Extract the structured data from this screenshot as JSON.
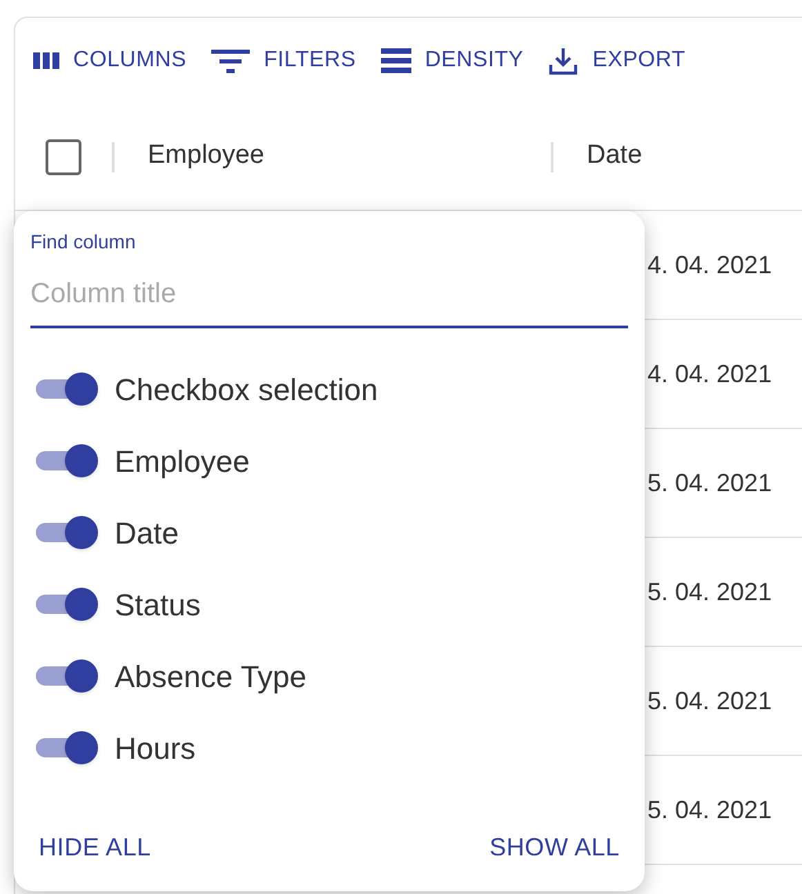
{
  "toolbar": [
    {
      "kind": "columns",
      "label": "COLUMNS"
    },
    {
      "kind": "filters",
      "label": "FILTERS"
    },
    {
      "kind": "density",
      "label": "DENSITY"
    },
    {
      "kind": "export",
      "label": "EXPORT"
    }
  ],
  "header": {
    "select_all_checked": false,
    "columns": [
      "Employee",
      "Date"
    ]
  },
  "rows": [
    {
      "date": "4. 04. 2021"
    },
    {
      "date": "4. 04. 2021"
    },
    {
      "date": "5. 04. 2021"
    },
    {
      "date": "5. 04. 2021"
    },
    {
      "date": "5. 04. 2021"
    },
    {
      "date": "5. 04. 2021"
    }
  ],
  "column_panel": {
    "label": "Find column",
    "placeholder": "Column title",
    "columns": [
      {
        "label": "Checkbox selection",
        "on": true
      },
      {
        "label": "Employee",
        "on": true
      },
      {
        "label": "Date",
        "on": true
      },
      {
        "label": "Status",
        "on": true
      },
      {
        "label": "Absence Type",
        "on": true
      },
      {
        "label": "Hours",
        "on": true
      }
    ],
    "actions": [
      "HIDE ALL",
      "SHOW ALL"
    ]
  }
}
